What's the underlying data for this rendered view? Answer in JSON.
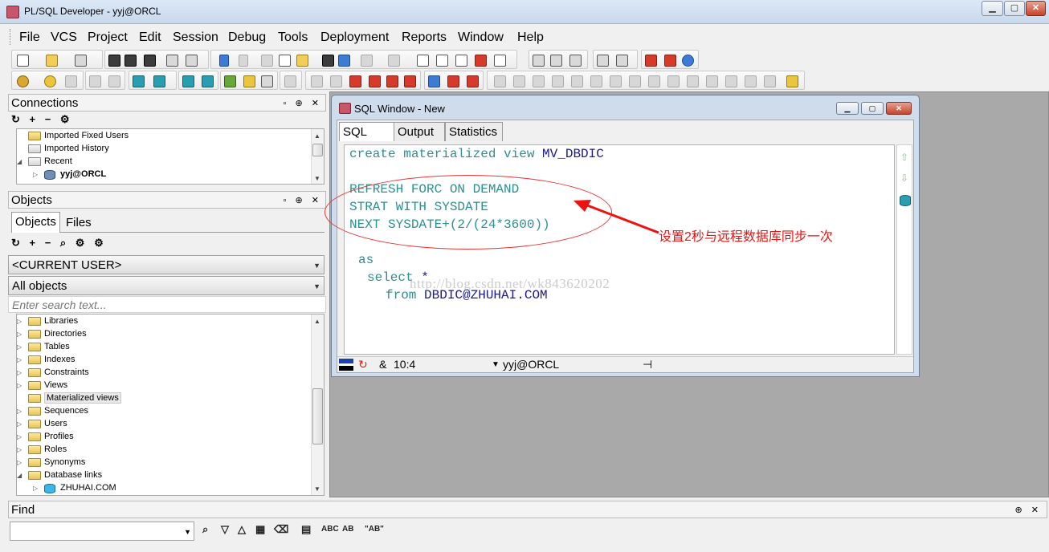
{
  "app": {
    "title": "PL/SQL Developer - yyj@ORCL",
    "window_controls": {
      "minimize": "▁",
      "maximize": "▢",
      "close": "✕"
    }
  },
  "menu": [
    "File",
    "VCS",
    "Project",
    "Edit",
    "Session",
    "Debug",
    "Tools",
    "Deployment",
    "Reports",
    "Window",
    "Help"
  ],
  "connections": {
    "header": "Connections",
    "pane_buttons": "▫ ⊕ ✕",
    "toolbar": "↻ + − ⚙",
    "items": [
      {
        "label": "Imported Fixed Users",
        "icon": "folder-icon"
      },
      {
        "label": "Imported History",
        "icon": "history-folder-icon"
      },
      {
        "label": "Recent",
        "icon": "recent-folder-icon"
      },
      {
        "label": "yyj@ORCL",
        "icon": "database-icon"
      }
    ]
  },
  "objects": {
    "header": "Objects",
    "pane_buttons": "▫ ⊕ ✕",
    "tabs": [
      "Objects",
      "Files"
    ],
    "toolbar": "↻ + − ⌕ ⚙ ⚙",
    "user_combo": "<CURRENT USER>",
    "filter_combo": "All objects",
    "search_placeholder": "Enter search text...",
    "items": [
      {
        "label": "Libraries"
      },
      {
        "label": "Directories"
      },
      {
        "label": "Tables"
      },
      {
        "label": "Indexes"
      },
      {
        "label": "Constraints"
      },
      {
        "label": "Views"
      },
      {
        "label": "Materialized views"
      },
      {
        "label": "Sequences"
      },
      {
        "label": "Users"
      },
      {
        "label": "Profiles"
      },
      {
        "label": "Roles"
      },
      {
        "label": "Synonyms"
      },
      {
        "label": "Database links"
      },
      {
        "label": "ZHUHAI.COM"
      }
    ]
  },
  "sql_window": {
    "title": "SQL Window - New",
    "tabs": [
      "SQL",
      "Output",
      "Statistics"
    ],
    "code": {
      "l1_kw": "create materialized view",
      "l1_id": "MV_DBDIC",
      "l2": "REFRESH FORC ON DEMAND",
      "l3_a": "STRAT WITH SYSDATE",
      "l4_a": "NEXT SYSDATE+(2/(24*3600))",
      "l5": "as",
      "l6_kw": "select",
      "l6_rest": "*",
      "l7_kw": "from",
      "l7_id": "DBDIC@ZHUHAI.COM"
    },
    "status": {
      "position": "10:4",
      "amp": "&",
      "connection": "yyj@ORCL",
      "pin": "⊣"
    }
  },
  "watermark": "http://blog.csdn.net/wk843620202",
  "annotation": "设置2秒与远程数据库同步一次",
  "find": {
    "header": "Find",
    "pane_buttons": "⊕ ✕",
    "tools": [
      "⌕",
      "▽",
      "△",
      "▦",
      "⌫",
      "▤",
      "ABC",
      "AB",
      "\"AB\""
    ]
  },
  "colors": {
    "keyword": "#2f8f8f",
    "identifier": "#1b1b8a",
    "annotation": "#e11111"
  }
}
